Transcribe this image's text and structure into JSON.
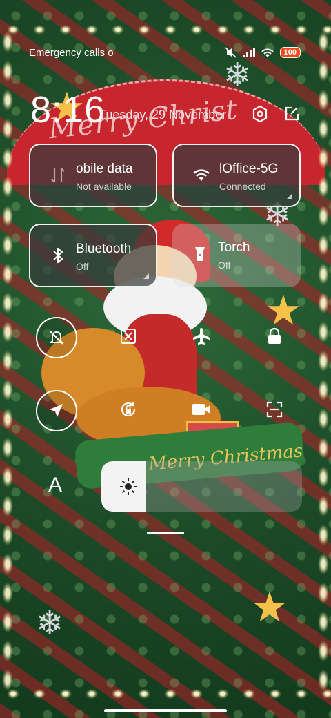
{
  "status_bar": {
    "carrier_text": "Emergency calls o",
    "icons": [
      "mute-icon",
      "signal-icon",
      "wifi-icon",
      "battery-icon"
    ],
    "battery": "100"
  },
  "header": {
    "time": "8:16",
    "date": "Tuesday, 29 November",
    "settings_icon": "gear-icon",
    "edit_icon": "edit-icon"
  },
  "tiles": [
    {
      "title": "obile data",
      "subtitle": "Not available",
      "icon": "mobile-data-icon",
      "state": "on"
    },
    {
      "title": "lOffice-5G",
      "subtitle": "Connected",
      "icon": "wifi-icon",
      "state": "on"
    },
    {
      "title": "Bluetooth",
      "subtitle": "Off",
      "icon": "bluetooth-icon",
      "state": "off"
    },
    {
      "title": "Torch",
      "subtitle": "Off",
      "icon": "torch-icon",
      "state": "off"
    }
  ],
  "toggles_row1": [
    "mute-icon",
    "screenshot-icon",
    "airplane-icon",
    "lock-icon"
  ],
  "toggles_row2": [
    "location-icon",
    "rotation-lock-icon",
    "video-icon",
    "scanner-icon"
  ],
  "brightness": {
    "auto_label": "A",
    "level": 0.22
  },
  "wallpaper_text": {
    "banner": "Merry Christ",
    "ribbon": "Merry Christmas"
  },
  "colors": {
    "accent": "#ffffff",
    "battery": "#f04a1c",
    "banner": "#c8262e"
  }
}
